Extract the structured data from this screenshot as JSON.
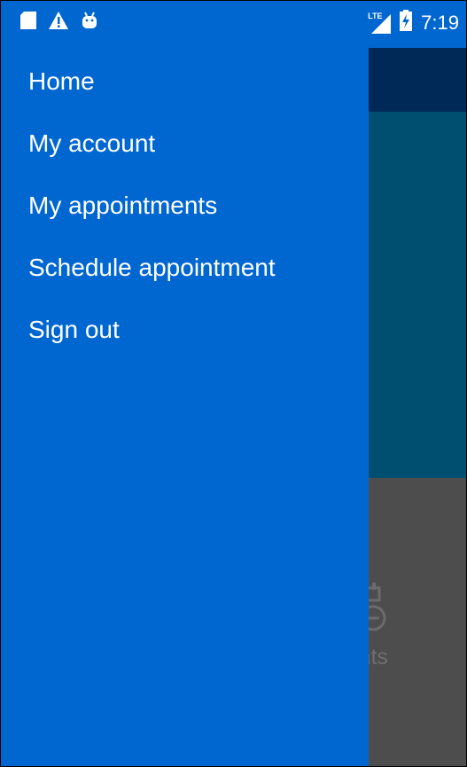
{
  "status_bar": {
    "time": "7:19",
    "network": "LTE",
    "icons_left": [
      "sd-card-icon",
      "warning-icon",
      "android-icon"
    ],
    "icons_right": [
      "lte-signal-icon",
      "battery-charging-icon"
    ]
  },
  "drawer": {
    "items": [
      {
        "label": "Home"
      },
      {
        "label": "My account"
      },
      {
        "label": "My appointments"
      },
      {
        "label": "Schedule appointment"
      },
      {
        "label": "Sign out"
      }
    ]
  },
  "background": {
    "card_label": "ntments",
    "card_icon": "calendar-clock-icon"
  },
  "colors": {
    "drawer": "#0167d0",
    "toolbar_dimmed": "#002958",
    "hero_dimmed": "#014f70",
    "content_dimmed": "#4d4d4d",
    "text": "#ffffff"
  }
}
